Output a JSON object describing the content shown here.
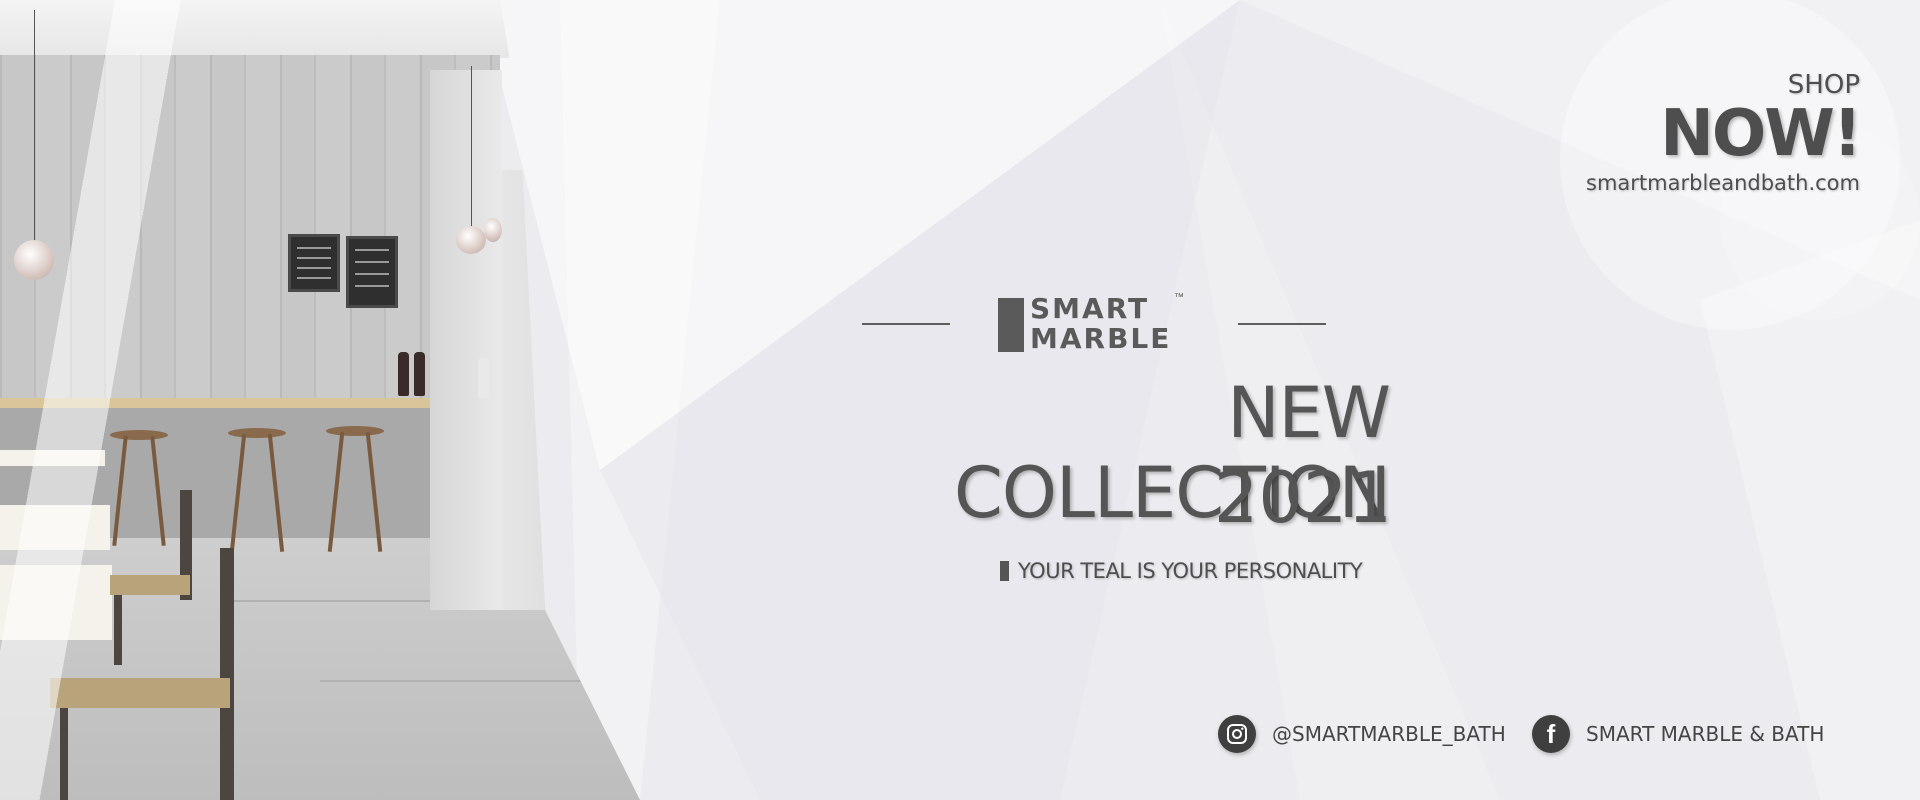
{
  "brand": {
    "logo_line1": "SMART",
    "logo_line2": "MARBLE",
    "trademark": "™"
  },
  "headline": {
    "title": "NEW COLLECTION",
    "year": "2021",
    "tagline": "YOUR TEAL IS YOUR PERSONALITY"
  },
  "cta": {
    "shop": "SHOP",
    "now": "NOW!",
    "website": "smartmarbleandbath.com"
  },
  "social": {
    "instagram": {
      "icon": "instagram-icon",
      "handle": "@SMARTMARBLE_BATH"
    },
    "facebook": {
      "icon": "facebook-icon",
      "glyph": "f",
      "name": "SMART MARBLE & BATH"
    }
  },
  "colors": {
    "background": "#ececf0",
    "text_dark": "#555555",
    "icon_bg": "#3f3f3f"
  }
}
